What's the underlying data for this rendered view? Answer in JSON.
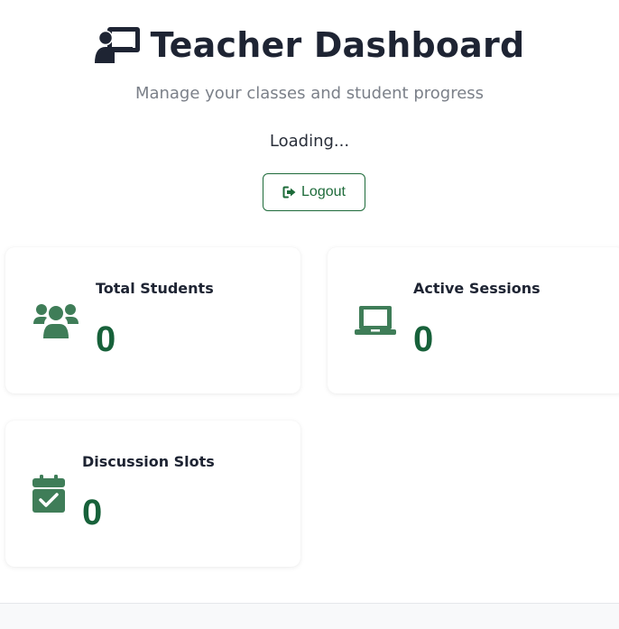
{
  "header": {
    "title": "Teacher Dashboard",
    "subtitle": "Manage your classes and student progress",
    "loading_text": "Loading...",
    "icon": "chalkboard-teacher-icon"
  },
  "actions": {
    "logout_label": "Logout",
    "logout_icon": "sign-out-icon"
  },
  "stats": [
    {
      "label": "Total Students",
      "value": "0",
      "icon": "users-icon"
    },
    {
      "label": "Active Sessions",
      "value": "0",
      "icon": "laptop-icon"
    },
    {
      "label": "Discussion Slots",
      "value": "0",
      "icon": "calendar-check-icon"
    }
  ],
  "colors": {
    "accent": "#1e6b3a",
    "icon_green": "#3f7d58",
    "value_green": "#17613a",
    "title": "#1e2433",
    "subtitle": "#7b8089"
  }
}
